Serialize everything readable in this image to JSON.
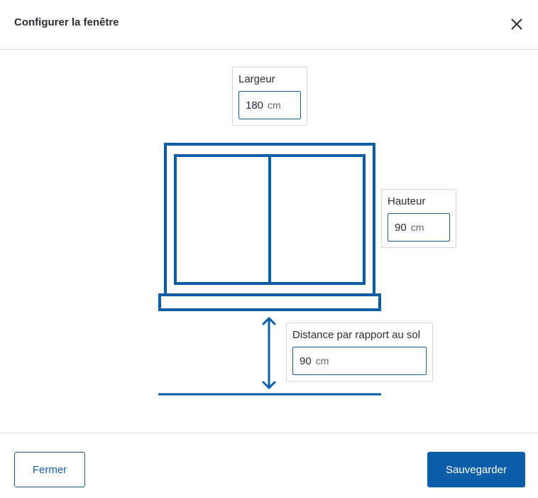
{
  "dialog": {
    "title": "Configurer la fenêtre",
    "close_icon": "close-icon"
  },
  "fields": {
    "width": {
      "label": "Largeur",
      "value": "180",
      "unit": "cm"
    },
    "height": {
      "label": "Hauteur",
      "value": "90",
      "unit": "cm"
    },
    "floor_distance": {
      "label": "Distance par rapport au sol",
      "value": "90",
      "unit": "cm"
    }
  },
  "footer": {
    "close_label": "Fermer",
    "save_label": "Sauvegarder"
  },
  "colors": {
    "accent": "#0c5ea8",
    "window_stroke": "#0a5ea8",
    "border": "#d9dde1"
  }
}
